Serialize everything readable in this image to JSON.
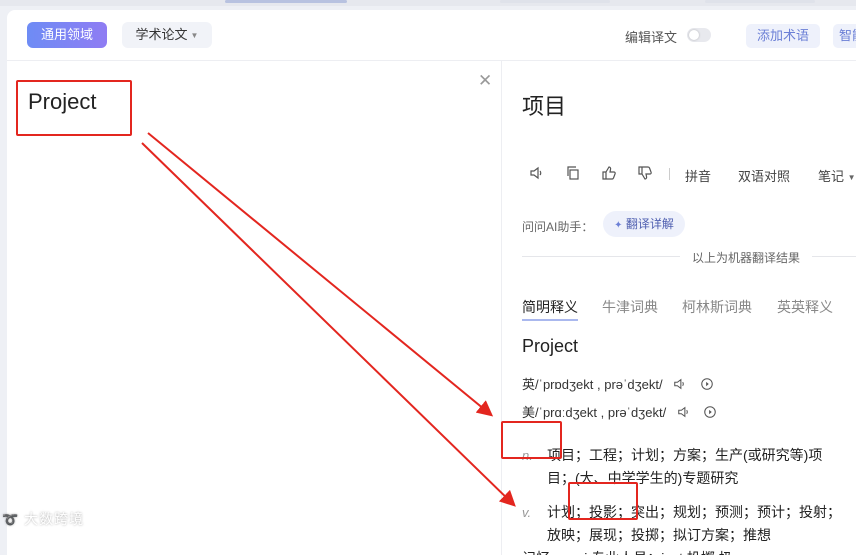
{
  "toolbar": {
    "domain_label": "通用领域",
    "paper_label": "学术论文",
    "edit_label": "编辑译文",
    "add_term_label": "添加术语",
    "smart_label": "智能"
  },
  "source": {
    "text": "Project"
  },
  "result": {
    "text": "项目"
  },
  "actions": {
    "pinyin_label": "拼音",
    "bilingual_label": "双语对照",
    "notes_label": "笔记"
  },
  "ai": {
    "prompt_label": "问问AI助手：",
    "detail_label": "翻译详解"
  },
  "divider_text": "以上为机器翻译结果",
  "tabs": [
    "简明释义",
    "牛津词典",
    "柯林斯词典",
    "英英释义"
  ],
  "dictionary": {
    "headword": "Project",
    "uk_pron": "英/ˈprɒdʒekt , prəˈdʒekt/",
    "us_pron": "美/ˈprɑːdʒekt , prəˈdʒekt/",
    "defs": [
      {
        "pos": "n.",
        "text": "项目；工程；计划；方案；生产(或研究等)项目；(大、中学学生的)专题研究"
      },
      {
        "pos": "v.",
        "text": "计划；投影；突出；规划；预测；预计；投射；放映；展现；投掷；拟订方案；推想"
      }
    ],
    "cut_line": "记忆，proj 专业人员；ject 投掷,扔"
  },
  "watermark": "大数跨境",
  "colors": {
    "accent": "#6e8cf5",
    "annotation": "#e3261f"
  }
}
